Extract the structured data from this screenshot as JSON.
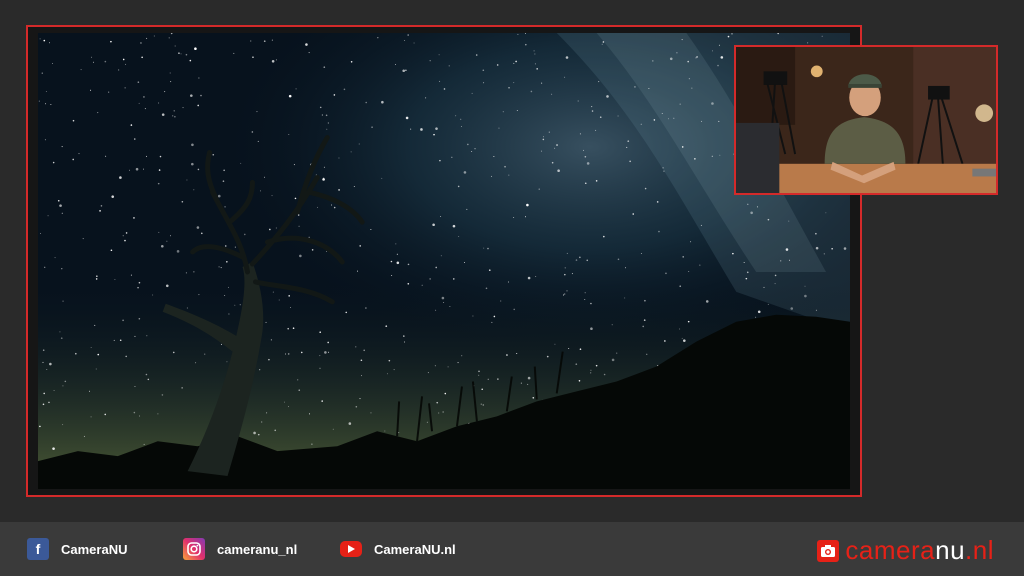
{
  "footer": {
    "facebook": {
      "icon": "facebook-icon",
      "label": "CameraNU"
    },
    "instagram": {
      "icon": "instagram-icon",
      "label": "cameranu_nl"
    },
    "youtube": {
      "icon": "youtube-icon",
      "label": "CameraNU.nl"
    },
    "brand": {
      "part1": "camera",
      "part2": "nu",
      "part3": ".nl",
      "icon": "camera-icon"
    }
  },
  "colors": {
    "frame_border": "#d42a2a",
    "footer_bg": "#3a3a3a",
    "stage_bg": "#2a2a2a",
    "accent": "#e62117"
  }
}
